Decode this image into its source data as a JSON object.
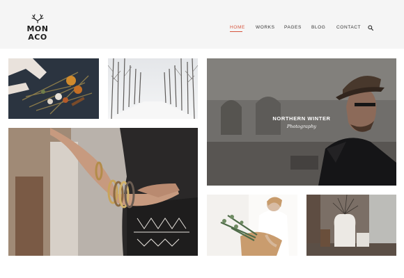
{
  "logo": {
    "line1": "MON",
    "line2": "ACO"
  },
  "nav": {
    "items": [
      {
        "label": "HOME",
        "active": true
      },
      {
        "label": "WORKS",
        "active": false
      },
      {
        "label": "PAGES",
        "active": false
      },
      {
        "label": "BLOG",
        "active": false
      },
      {
        "label": "CONTACT",
        "active": false
      }
    ],
    "search_icon": "search-icon",
    "accent_color": "#d6543b"
  },
  "gallery": {
    "featured": {
      "title": "NORTHERN WINTER",
      "subtitle": "Photography"
    },
    "tiles": [
      {
        "name": "dried-flowers-photo"
      },
      {
        "name": "snowy-forest-road-photo"
      },
      {
        "name": "northern-winter-photo"
      },
      {
        "name": "bracelets-fashion-photo"
      },
      {
        "name": "wrapped-bouquet-photo"
      },
      {
        "name": "vase-still-life-photo"
      }
    ]
  }
}
